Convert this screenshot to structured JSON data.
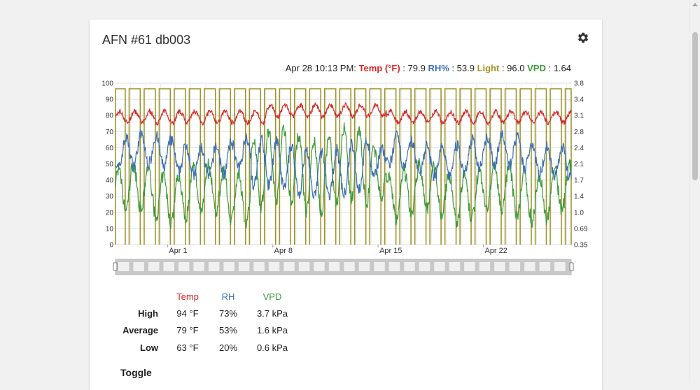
{
  "card": {
    "title": "AFN #61 db003"
  },
  "icons": {
    "settings": "gear-icon"
  },
  "readout": {
    "timestamp": "Apr 28 10:13 PM:",
    "temp_label": "Temp (°F)",
    "temp_value": "79.9",
    "rh_label": "RH%",
    "rh_value": "53.9",
    "light_label": "Light",
    "light_value": "96.0",
    "vpd_label": "VPD",
    "vpd_value": "1.64"
  },
  "colors": {
    "temp": "#d62728",
    "rh": "#3b6fb6",
    "light": "#a0942a",
    "vpd": "#3a9a3a",
    "grid": "#dedede"
  },
  "chart_data": {
    "type": "line",
    "y_left_ticks": [
      "100",
      "90",
      "80",
      "70",
      "60",
      "50",
      "40",
      "30",
      "20",
      "10",
      "0"
    ],
    "y_right_ticks": [
      "3.8",
      "3.4",
      "3.1",
      "2.8",
      "2.4",
      "2.1",
      "1.7",
      "1.4",
      "1.0",
      "0.69",
      "0.35"
    ],
    "x_ticks": [
      "Apr 1",
      "Apr 8",
      "Apr 15",
      "Apr 22"
    ],
    "ylim_left": [
      0,
      100
    ],
    "ylim_right": [
      0.35,
      3.8
    ],
    "grid": true,
    "series": [
      {
        "name": "Temp (°F)",
        "axis": "left",
        "range": [
          63,
          94
        ],
        "typical": 79
      },
      {
        "name": "RH%",
        "axis": "left",
        "range": [
          20,
          73
        ],
        "typical": 53
      },
      {
        "name": "Light",
        "axis": "left",
        "values_on": 96,
        "values_off": 0,
        "cycle": "daily on/off"
      },
      {
        "name": "VPD",
        "axis": "right",
        "range": [
          0.6,
          3.7
        ],
        "typical": 1.6
      }
    ]
  },
  "stats": {
    "headers": {
      "temp": "Temp",
      "rh": "RH",
      "vpd": "VPD"
    },
    "rows": [
      {
        "label": "High",
        "temp": "94 °F",
        "rh": "73%",
        "vpd": "3.7 kPa"
      },
      {
        "label": "Average",
        "temp": "79 °F",
        "rh": "53%",
        "vpd": "1.6 kPa"
      },
      {
        "label": "Low",
        "temp": "63 °F",
        "rh": "20%",
        "vpd": "0.6 kPa"
      }
    ]
  },
  "toggle": {
    "label": "Toggle"
  }
}
